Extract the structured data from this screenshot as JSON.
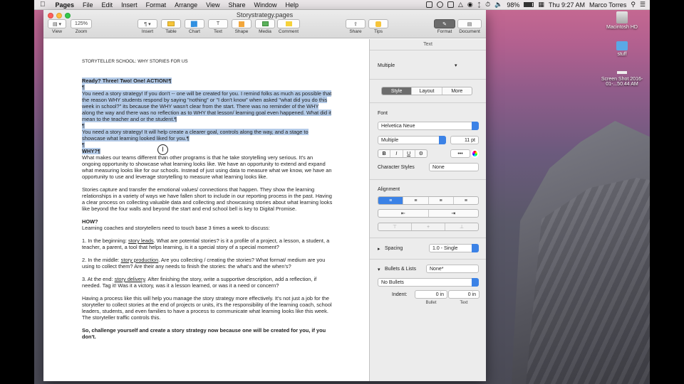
{
  "menubar": {
    "app": "Pages",
    "items": [
      "File",
      "Edit",
      "Insert",
      "Format",
      "Arrange",
      "View",
      "Share",
      "Window",
      "Help"
    ],
    "battery": "98%",
    "clock": "Thu 9:27 AM",
    "user": "Marco Torres"
  },
  "desktop": {
    "icons": [
      {
        "label": "Macintosh HD"
      },
      {
        "label": "stuff"
      },
      {
        "label": "Screen Shot 2016-01-...50.44 AM"
      }
    ]
  },
  "window": {
    "title": "Storystrategy.pages",
    "toolbar": {
      "view": "View",
      "zoom": "Zoom",
      "zoom_value": "125%",
      "insert": "Insert",
      "table": "Table",
      "chart": "Chart",
      "text": "Text",
      "shape": "Shape",
      "media": "Media",
      "comment": "Comment",
      "share": "Share",
      "tips": "Tips",
      "format": "Format",
      "document": "Document"
    }
  },
  "document": {
    "header": "STORYTELLER SCHOOL: WHY STORIES FOR US",
    "p1": "Ready? Three! Two! One! ACTION!¶",
    "p1b": "¶",
    "p2": "You need a story strategy! If you don't -- one will be created for you. I remind folks as much as possible that the reason WHY students respond by saying \"nothing\" or \"I don't know\" when asked \"what did you do this week in school?\" its because the WHY wasn't clear from the start. There was no reminder of the WHY along the way and there was no reflection as to WHY that lesson/ learning goal even happened. What did it mean to the teacher and or the student.¶",
    "p2b": "¶",
    "p3": "You need a story strategy! It will help create a clearer goal, controls along the way, and a stage to showcase what learning looked liked for you.¶",
    "p3b": "¶",
    "why": "WHY?¶",
    "p4": "What makes our teams different than other programs is that he take storytelling very serious. It's an ongoing opportunity to showcase what learning looks like. We have an opportunity to extend and expand what measuring looks like for our schools. Instead of just using data to measure what we know, we have an opportunity to use and leverage storytelling to measure what learning looks like.",
    "p5": "Stories capture and transfer the emotional values/ connections that happen. They show the learning relationships in a variety of ways we have fallen short to include in our reporting process in the past. Having a clear process on collecting valuable data and collecting and showcasing stories about what learning looks like beyond the four walls and beyond the start and end school bell is key to Digital Promise.",
    "how": "HOW?",
    "p6": "Learning coaches and storytellers need to touch base 3 times a week to discuss:",
    "l1a": "1. In the beginning: ",
    "l1u": "story leads",
    "l1b": ". What are potential stories? is it a profile of a project, a lesson, a student, a teacher, a parent, a tool that helps learning, is it a special story of a special moment?",
    "l2a": "2. In the middle: ",
    "l2u": "story production",
    "l2b": ". Are you collecting / creating the stories? What format/ medium are you using to collect them? Are their any needs to finish the stories: the what's and the when's?",
    "l3a": "3. At the end: ",
    "l3u": "story delivery",
    "l3b": ". After finishing the story, write a supportive description, add a reflection, if needed. Tag it! Was it a victory, was it a lesson learned, or was it a need or concern?",
    "p7": "Having a process like this will help you manage the story strategy more effectively. It's not just a job for the storyteller to collect stories at the end of projects or units, it's the responsibility of the learning coach, school leaders, students, and even families to have a process to communicate what learning looks like this week. The storyteller traffic controls this.",
    "p8": "So, challenge yourself and create a story strategy now because one will be created for you, if you don't."
  },
  "inspector": {
    "header": "Text",
    "style_name": "Multiple",
    "tabs": [
      "Style",
      "Layout",
      "More"
    ],
    "font_label": "Font",
    "font_family": "Helvetica Neue",
    "font_typeface": "Multiple",
    "font_size": "11 pt",
    "format_buttons": [
      "B",
      "I",
      "U"
    ],
    "char_styles_label": "Character Styles",
    "char_styles_value": "None",
    "alignment_label": "Alignment",
    "spacing_label": "Spacing",
    "spacing_value": "1.0 - Single",
    "bullets_label": "Bullets & Lists",
    "bullets_value": "None*",
    "bullets_type": "No Bullets",
    "indent_label": "Indent:",
    "indent_bullet": "0 in",
    "indent_text": "0 in",
    "bullet_caption": "Bullet",
    "text_caption": "Text"
  },
  "colors": {
    "accent": "#3b82e6",
    "selection": "#b4cbe8"
  }
}
